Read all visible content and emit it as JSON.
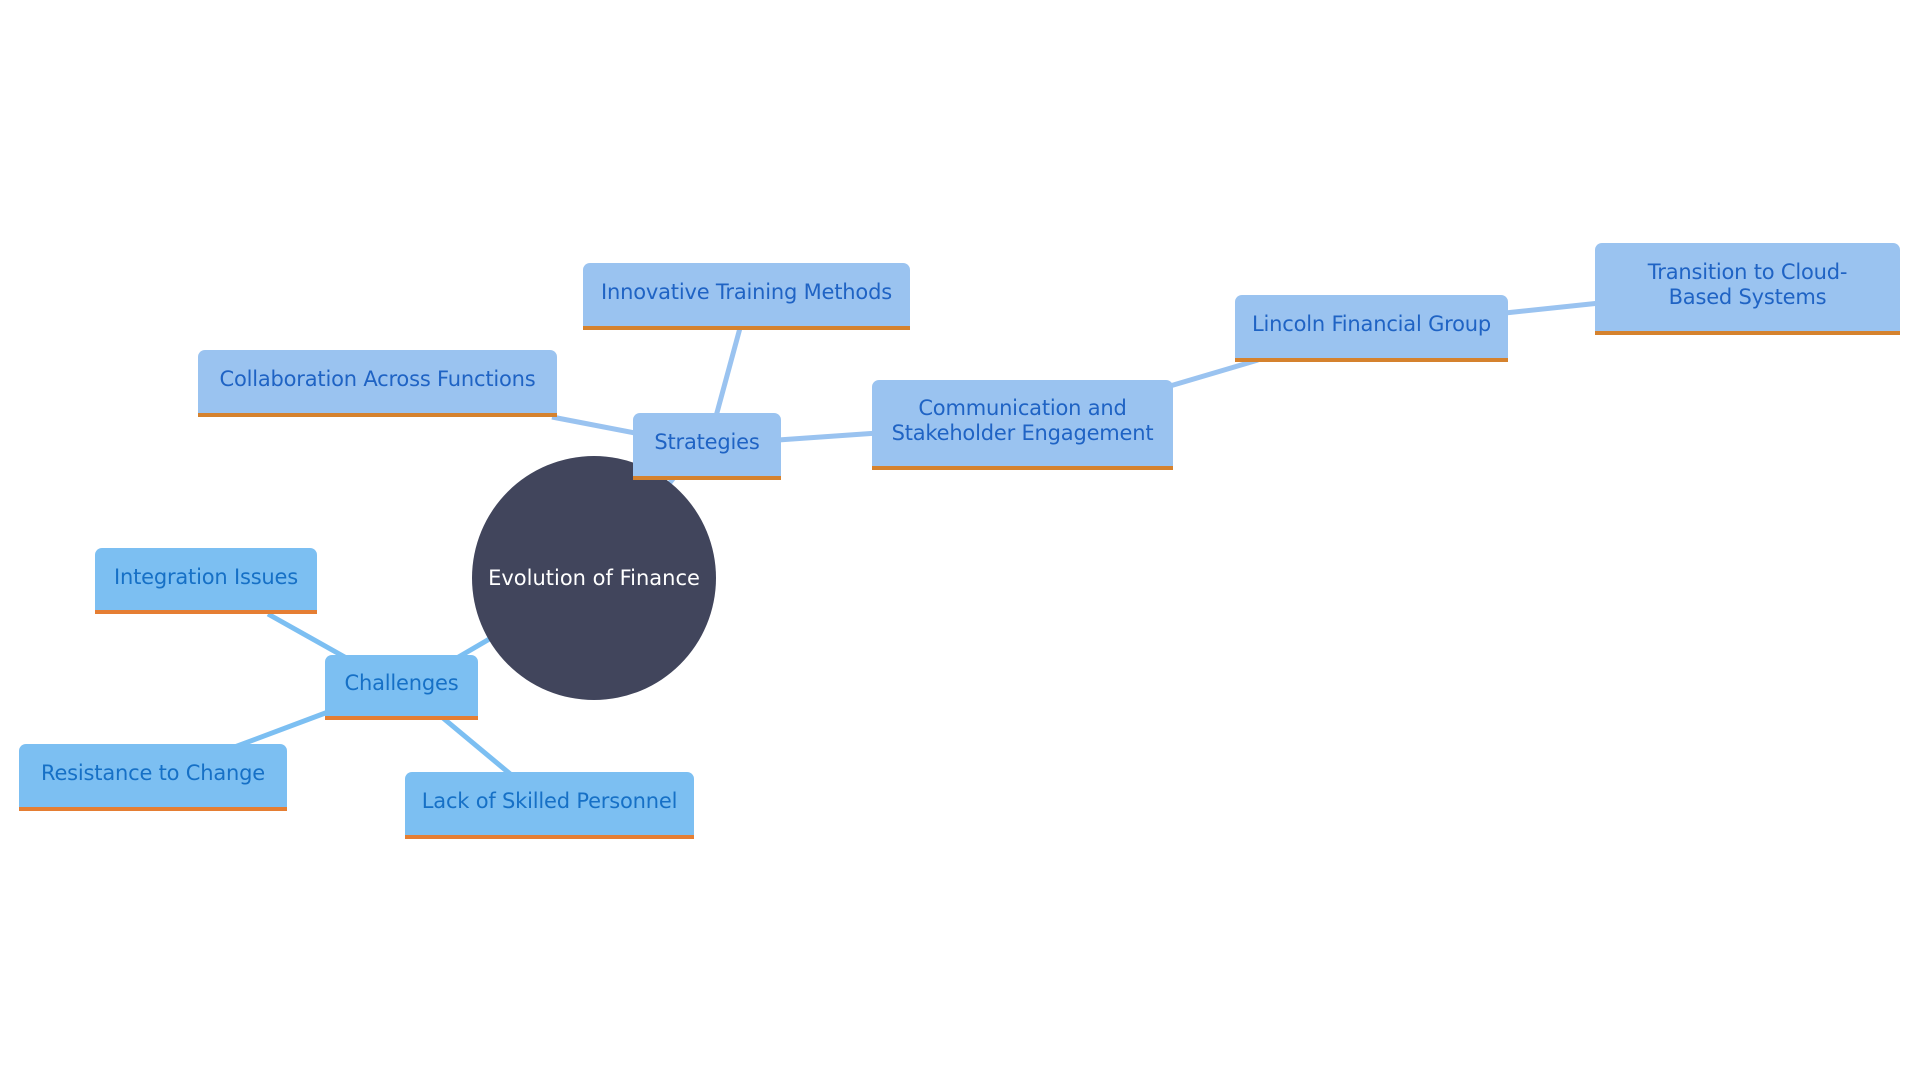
{
  "diagram": {
    "type": "mindmap",
    "root": {
      "id": "root",
      "label": "Evolution of Finance"
    },
    "nodes": [
      {
        "id": "strategies",
        "label": "Strategies",
        "branch": "strategies",
        "parent": "root"
      },
      {
        "id": "innovative",
        "label": "Innovative Training Methods",
        "branch": "strategies",
        "parent": "strategies"
      },
      {
        "id": "collaboration",
        "label": "Collaboration Across Functions",
        "branch": "strategies",
        "parent": "strategies"
      },
      {
        "id": "communication",
        "label": "Communication and Stakeholder Engagement",
        "branch": "strategies",
        "parent": "strategies"
      },
      {
        "id": "lincoln",
        "label": "Lincoln Financial Group",
        "branch": "strategies",
        "parent": "communication"
      },
      {
        "id": "transition",
        "label": "Transition to Cloud-Based Systems",
        "branch": "strategies",
        "parent": "lincoln"
      },
      {
        "id": "challenges",
        "label": "Challenges",
        "branch": "challenges",
        "parent": "root"
      },
      {
        "id": "integration",
        "label": "Integration Issues",
        "branch": "challenges",
        "parent": "challenges"
      },
      {
        "id": "resistance",
        "label": "Resistance to Change",
        "branch": "challenges",
        "parent": "challenges"
      },
      {
        "id": "lack",
        "label": "Lack of Skilled Personnel",
        "branch": "challenges",
        "parent": "challenges"
      }
    ]
  },
  "colors": {
    "root_fill": "#41455c",
    "strategies_fill": "#9ac3f0",
    "strategies_edge": "#9ac3f0",
    "strategies_accent": "#d5822e",
    "challenges_fill": "#7cbff2",
    "challenges_edge": "#7cbff2",
    "challenges_accent": "#e57e33"
  }
}
